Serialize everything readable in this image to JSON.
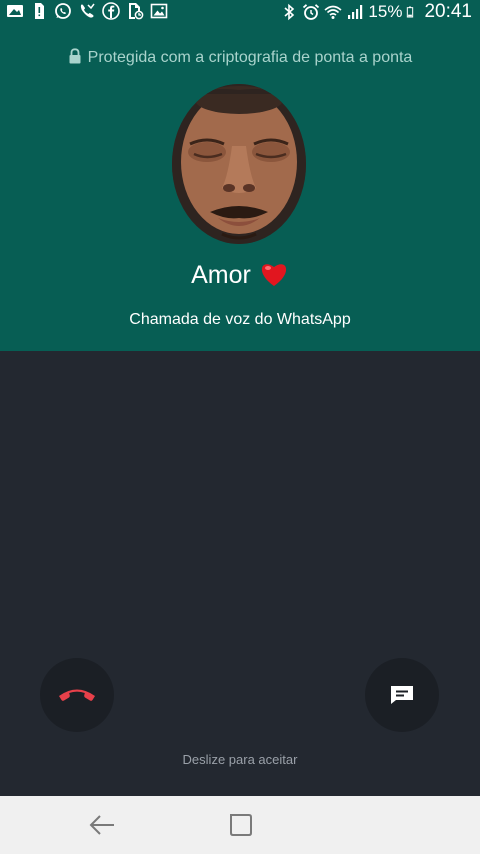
{
  "status_bar": {
    "notification_icons": [
      "gallery-icon",
      "sim-icon",
      "whatsapp-icon",
      "missed-call-icon",
      "facebook-icon",
      "file-sync-icon",
      "image-icon"
    ],
    "system_icons": [
      "bluetooth-icon",
      "alarm-icon",
      "wifi-icon",
      "signal-icon",
      "battery-icon"
    ],
    "battery": "15%",
    "time": "20:41"
  },
  "header": {
    "encryption_text": "Protegida com a criptografia de ponta a ponta",
    "caller_name": "Amor",
    "call_type": "Chamada de voz do WhatsApp",
    "background_color": "#075E54"
  },
  "actions": {
    "decline_icon": "phone-hangup-icon",
    "decline_color": "#E8404A",
    "reply_icon": "message-icon",
    "swipe_hint": "Deslize para aceitar"
  },
  "nav_bar": {
    "back_icon": "back-arrow-icon",
    "home_icon": "home-square-icon"
  }
}
